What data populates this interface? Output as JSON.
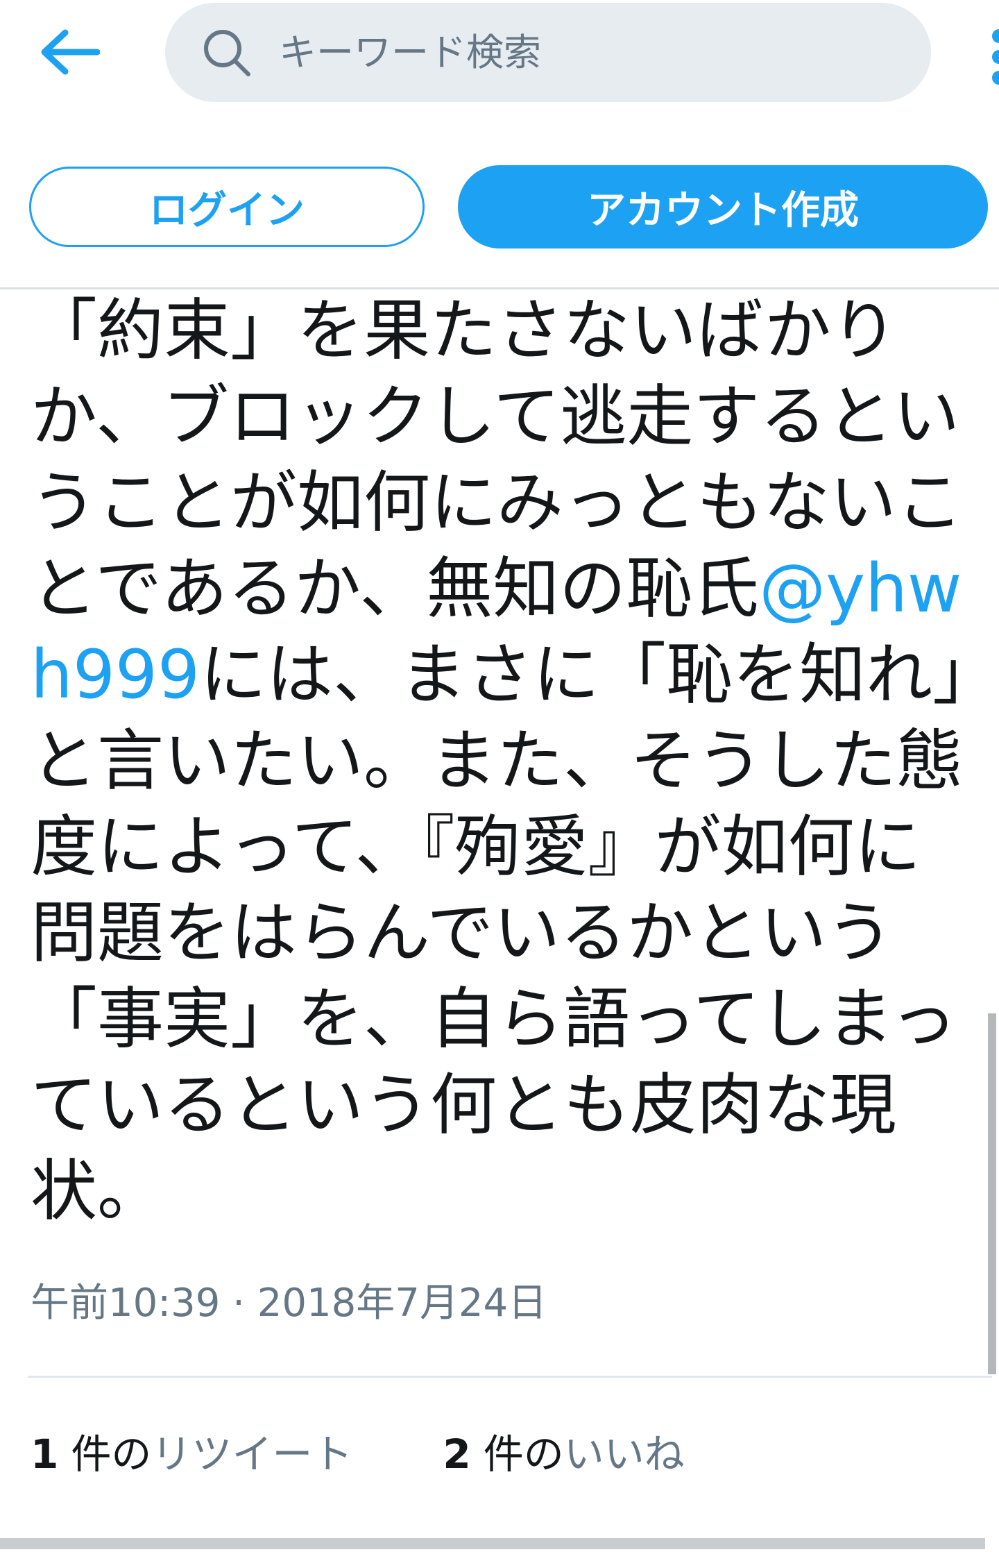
{
  "header": {
    "back_icon": "arrow-left-icon",
    "search_icon": "search-icon",
    "search_placeholder": "キーワード検索",
    "more_icon": "more-vertical-icon"
  },
  "auth": {
    "login_label": "ログイン",
    "signup_label": "アカウント作成"
  },
  "tweet": {
    "text_before_mention": "「約束」を果たさないばかりか、ブロックして逃走するということが如何にみっともないことであるか、無知の恥氏",
    "mention": "@yhwh999",
    "text_after_mention": "には、まさに「恥を知れ」と言いたい。また、そうした態度によって、『殉愛』が如何に問題をはらんでいるかという「事実」を、自ら語ってしまっているという何とも皮肉な現状。",
    "timestamp": "午前10:39 · 2018年7月24日"
  },
  "stats": {
    "retweets_count": "1",
    "retweets_unit": "件の",
    "retweets_label": "リツイート",
    "likes_count": "2",
    "likes_unit": "件の",
    "likes_label": "いいね"
  },
  "colors": {
    "accent": "#1da1f2",
    "muted": "#657786",
    "text": "#14171a",
    "search_bg": "#e6ecf0"
  }
}
